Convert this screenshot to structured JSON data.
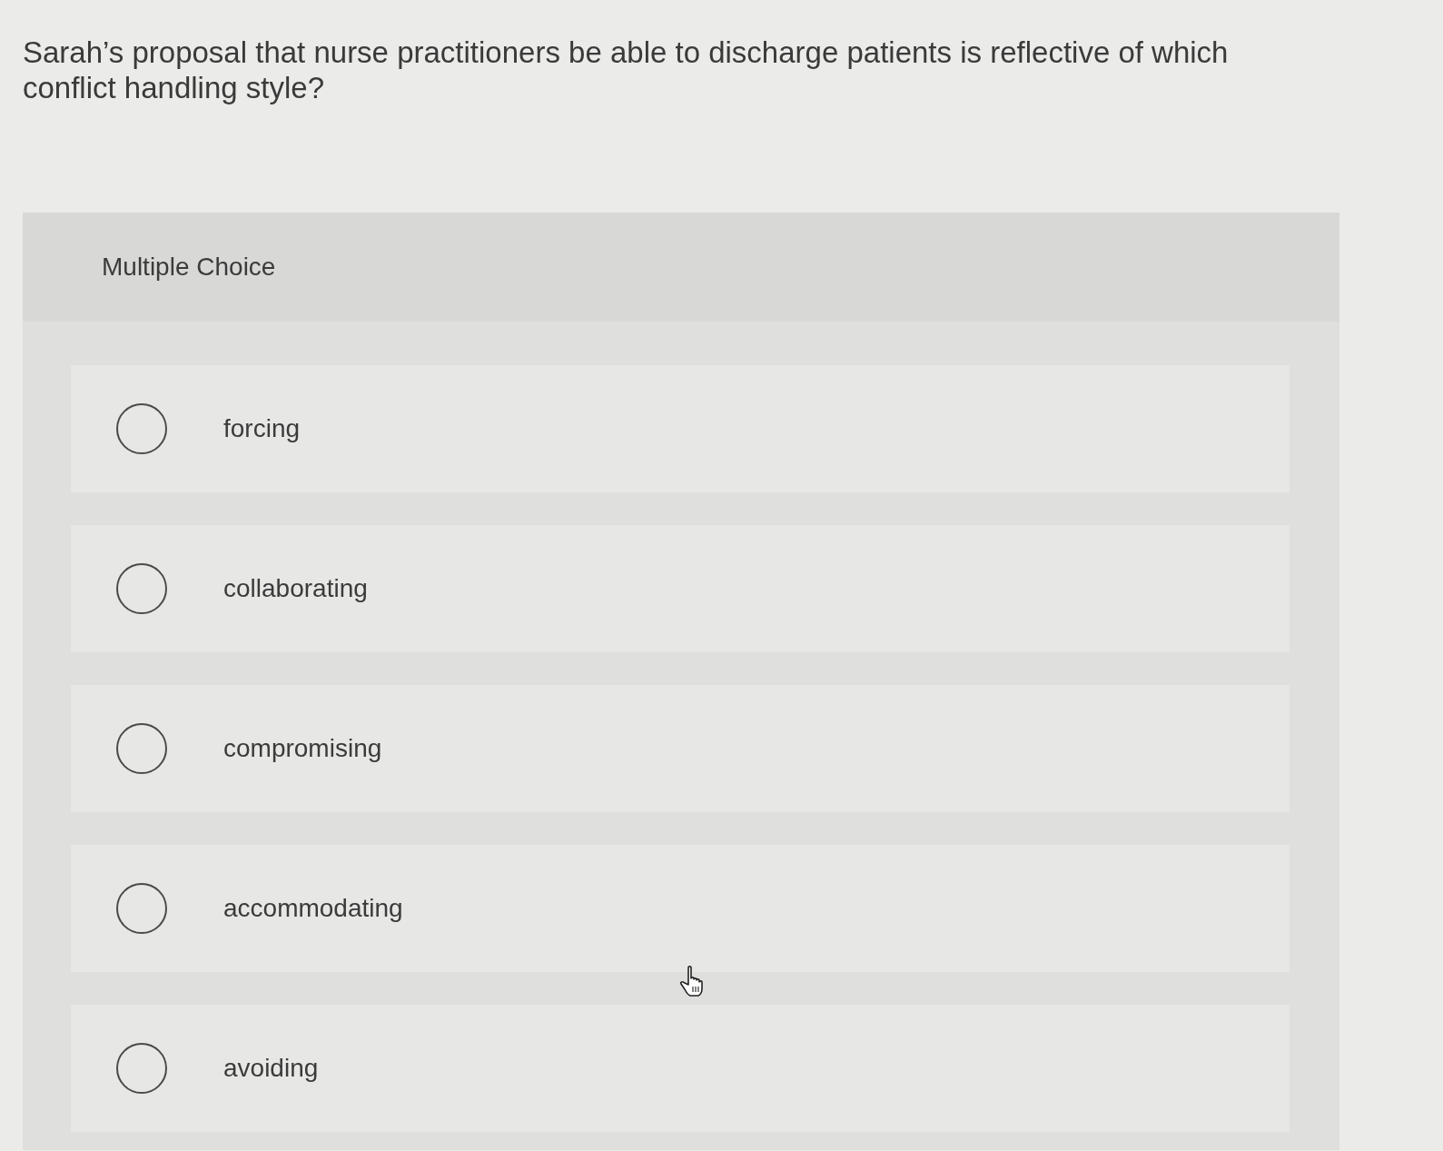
{
  "question": "Sarah’s proposal that nurse practitioners be able to discharge patients is reflective of which conflict handling style?",
  "panel": {
    "title": "Multiple Choice"
  },
  "options": [
    {
      "label": "forcing",
      "selected": false
    },
    {
      "label": "collaborating",
      "selected": false
    },
    {
      "label": "compromising",
      "selected": false
    },
    {
      "label": "accommodating",
      "selected": false
    },
    {
      "label": "avoiding",
      "selected": false
    }
  ]
}
